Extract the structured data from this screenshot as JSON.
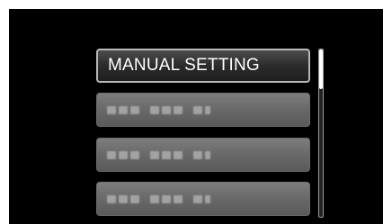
{
  "menu": {
    "items": [
      {
        "label": "MANUAL SETTING",
        "selected": true
      },
      {
        "label": "",
        "selected": false
      },
      {
        "label": "",
        "selected": false
      },
      {
        "label": "",
        "selected": false
      }
    ]
  },
  "scrollbar": {
    "position_fraction": 0.0
  },
  "colors": {
    "screen_background": "#000000",
    "item_background": "#6a6a6a",
    "selected_item_background": "#2c2c2c",
    "text": "#ffffff"
  }
}
